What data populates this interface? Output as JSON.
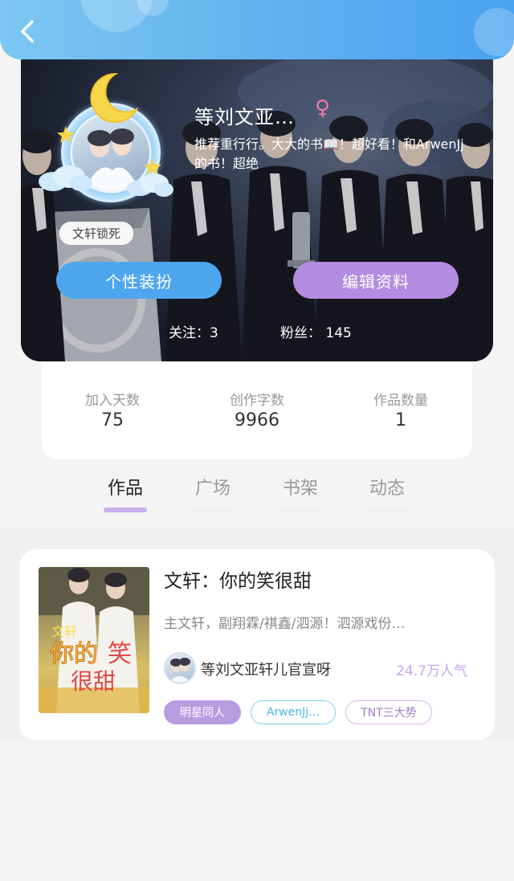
{
  "nav": {
    "back_icon": "chevron-left-icon"
  },
  "profile": {
    "name": "等刘文亚…",
    "gender_symbol": "♀",
    "bio": "推荐重行行。大大的书📖！超好看！和ArwenJj的书！超绝",
    "badge": "文轩锁死",
    "dress_button": "个性装扮",
    "edit_button": "编辑资料",
    "following_label": "关注：",
    "following_count": "3",
    "fans_label": "粉丝：",
    "fans_count": "145"
  },
  "stats": [
    {
      "label": "加入天数",
      "value": "75"
    },
    {
      "label": "创作字数",
      "value": "9966"
    },
    {
      "label": "作品数量",
      "value": "1"
    }
  ],
  "tabs": [
    {
      "label": "作品",
      "active": true
    },
    {
      "label": "广场",
      "active": false
    },
    {
      "label": "书架",
      "active": false
    },
    {
      "label": "动态",
      "active": false
    }
  ],
  "work": {
    "title": "文轩：你的笑很甜",
    "description": "主文轩，副翔霖/祺鑫/泗源！泗源戏份…",
    "author": "等刘文亚轩儿官宣呀",
    "popularity": "24.7万人气",
    "tags": [
      "明星同人",
      "ArwenJj…",
      "TNT三大势"
    ],
    "cover_text": [
      "文轩",
      "你的",
      "笑",
      "很甜"
    ]
  },
  "colors": {
    "topbar_start": "#7cc8f2",
    "topbar_end": "#4aa3f0",
    "blue_button": "#4ea6ee",
    "purple_button": "#b48ce0",
    "active_tab_underline": "#c8b0ec",
    "popularity": "#c6a6ea"
  }
}
